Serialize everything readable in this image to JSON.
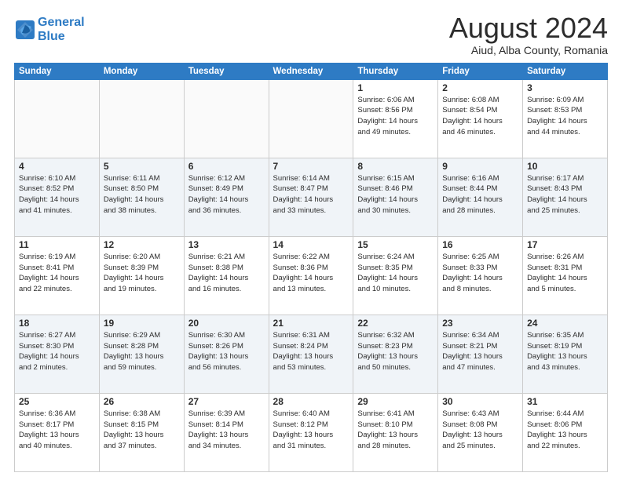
{
  "header": {
    "logo_line1": "General",
    "logo_line2": "Blue",
    "month": "August 2024",
    "location": "Aiud, Alba County, Romania"
  },
  "weekdays": [
    "Sunday",
    "Monday",
    "Tuesday",
    "Wednesday",
    "Thursday",
    "Friday",
    "Saturday"
  ],
  "weeks": [
    [
      {
        "day": "",
        "info": ""
      },
      {
        "day": "",
        "info": ""
      },
      {
        "day": "",
        "info": ""
      },
      {
        "day": "",
        "info": ""
      },
      {
        "day": "1",
        "info": "Sunrise: 6:06 AM\nSunset: 8:56 PM\nDaylight: 14 hours\nand 49 minutes."
      },
      {
        "day": "2",
        "info": "Sunrise: 6:08 AM\nSunset: 8:54 PM\nDaylight: 14 hours\nand 46 minutes."
      },
      {
        "day": "3",
        "info": "Sunrise: 6:09 AM\nSunset: 8:53 PM\nDaylight: 14 hours\nand 44 minutes."
      }
    ],
    [
      {
        "day": "4",
        "info": "Sunrise: 6:10 AM\nSunset: 8:52 PM\nDaylight: 14 hours\nand 41 minutes."
      },
      {
        "day": "5",
        "info": "Sunrise: 6:11 AM\nSunset: 8:50 PM\nDaylight: 14 hours\nand 38 minutes."
      },
      {
        "day": "6",
        "info": "Sunrise: 6:12 AM\nSunset: 8:49 PM\nDaylight: 14 hours\nand 36 minutes."
      },
      {
        "day": "7",
        "info": "Sunrise: 6:14 AM\nSunset: 8:47 PM\nDaylight: 14 hours\nand 33 minutes."
      },
      {
        "day": "8",
        "info": "Sunrise: 6:15 AM\nSunset: 8:46 PM\nDaylight: 14 hours\nand 30 minutes."
      },
      {
        "day": "9",
        "info": "Sunrise: 6:16 AM\nSunset: 8:44 PM\nDaylight: 14 hours\nand 28 minutes."
      },
      {
        "day": "10",
        "info": "Sunrise: 6:17 AM\nSunset: 8:43 PM\nDaylight: 14 hours\nand 25 minutes."
      }
    ],
    [
      {
        "day": "11",
        "info": "Sunrise: 6:19 AM\nSunset: 8:41 PM\nDaylight: 14 hours\nand 22 minutes."
      },
      {
        "day": "12",
        "info": "Sunrise: 6:20 AM\nSunset: 8:39 PM\nDaylight: 14 hours\nand 19 minutes."
      },
      {
        "day": "13",
        "info": "Sunrise: 6:21 AM\nSunset: 8:38 PM\nDaylight: 14 hours\nand 16 minutes."
      },
      {
        "day": "14",
        "info": "Sunrise: 6:22 AM\nSunset: 8:36 PM\nDaylight: 14 hours\nand 13 minutes."
      },
      {
        "day": "15",
        "info": "Sunrise: 6:24 AM\nSunset: 8:35 PM\nDaylight: 14 hours\nand 10 minutes."
      },
      {
        "day": "16",
        "info": "Sunrise: 6:25 AM\nSunset: 8:33 PM\nDaylight: 14 hours\nand 8 minutes."
      },
      {
        "day": "17",
        "info": "Sunrise: 6:26 AM\nSunset: 8:31 PM\nDaylight: 14 hours\nand 5 minutes."
      }
    ],
    [
      {
        "day": "18",
        "info": "Sunrise: 6:27 AM\nSunset: 8:30 PM\nDaylight: 14 hours\nand 2 minutes."
      },
      {
        "day": "19",
        "info": "Sunrise: 6:29 AM\nSunset: 8:28 PM\nDaylight: 13 hours\nand 59 minutes."
      },
      {
        "day": "20",
        "info": "Sunrise: 6:30 AM\nSunset: 8:26 PM\nDaylight: 13 hours\nand 56 minutes."
      },
      {
        "day": "21",
        "info": "Sunrise: 6:31 AM\nSunset: 8:24 PM\nDaylight: 13 hours\nand 53 minutes."
      },
      {
        "day": "22",
        "info": "Sunrise: 6:32 AM\nSunset: 8:23 PM\nDaylight: 13 hours\nand 50 minutes."
      },
      {
        "day": "23",
        "info": "Sunrise: 6:34 AM\nSunset: 8:21 PM\nDaylight: 13 hours\nand 47 minutes."
      },
      {
        "day": "24",
        "info": "Sunrise: 6:35 AM\nSunset: 8:19 PM\nDaylight: 13 hours\nand 43 minutes."
      }
    ],
    [
      {
        "day": "25",
        "info": "Sunrise: 6:36 AM\nSunset: 8:17 PM\nDaylight: 13 hours\nand 40 minutes."
      },
      {
        "day": "26",
        "info": "Sunrise: 6:38 AM\nSunset: 8:15 PM\nDaylight: 13 hours\nand 37 minutes."
      },
      {
        "day": "27",
        "info": "Sunrise: 6:39 AM\nSunset: 8:14 PM\nDaylight: 13 hours\nand 34 minutes."
      },
      {
        "day": "28",
        "info": "Sunrise: 6:40 AM\nSunset: 8:12 PM\nDaylight: 13 hours\nand 31 minutes."
      },
      {
        "day": "29",
        "info": "Sunrise: 6:41 AM\nSunset: 8:10 PM\nDaylight: 13 hours\nand 28 minutes."
      },
      {
        "day": "30",
        "info": "Sunrise: 6:43 AM\nSunset: 8:08 PM\nDaylight: 13 hours\nand 25 minutes."
      },
      {
        "day": "31",
        "info": "Sunrise: 6:44 AM\nSunset: 8:06 PM\nDaylight: 13 hours\nand 22 minutes."
      }
    ]
  ]
}
